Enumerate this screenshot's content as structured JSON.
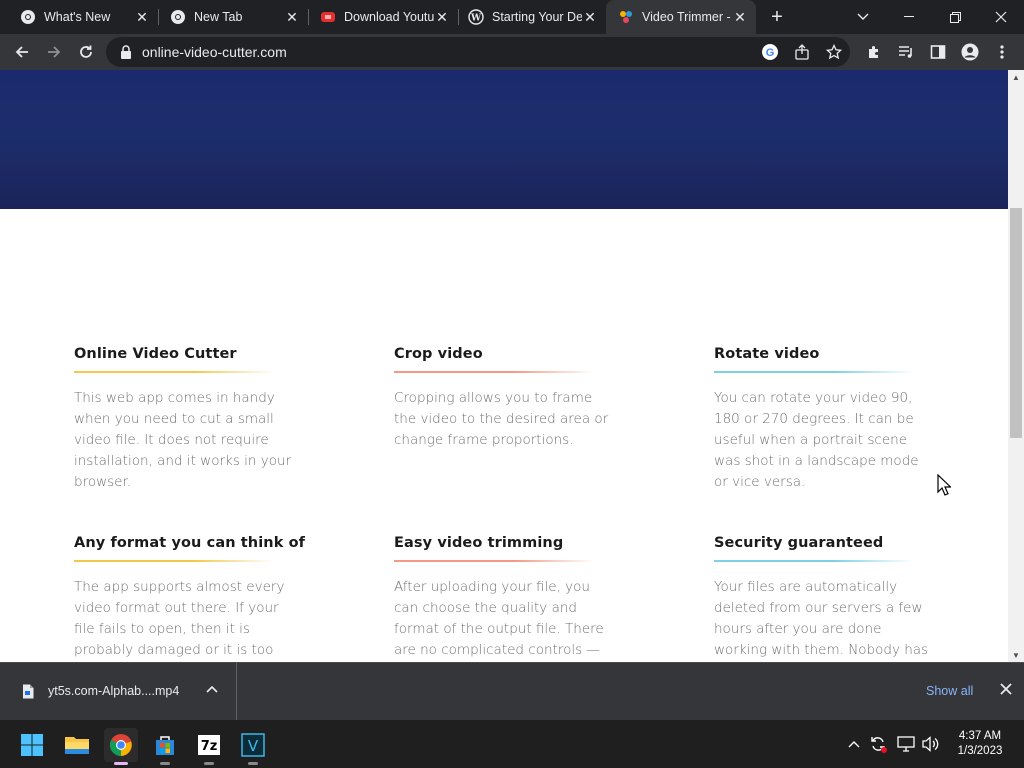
{
  "browser": {
    "tabs": [
      {
        "title": "What's New",
        "favicon": "chrome-logo-icon",
        "active": false
      },
      {
        "title": "New Tab",
        "favicon": "chrome-logo-icon",
        "active": false
      },
      {
        "title": "Download Youtu",
        "favicon": "youtube-download-icon",
        "active": false
      },
      {
        "title": "Starting Your De",
        "favicon": "wordpress-icon",
        "active": false
      },
      {
        "title": "Video Trimmer -",
        "favicon": "video-trimmer-icon",
        "active": true
      }
    ],
    "url": "online-video-cutter.com"
  },
  "page": {
    "features": [
      {
        "title": "Online Video Cutter",
        "text": "This web app comes in handy when you need to cut a small video file. It does not require installation, and it works in your browser.",
        "accent": "#f3c84a"
      },
      {
        "title": "Crop video",
        "text": "Cropping allows you to frame the video to the desired area or change frame proportions.",
        "accent": "#f29a86"
      },
      {
        "title": "Rotate video",
        "text": "You can rotate your video 90, 180 or 270 degrees. It can be useful when a portrait scene was shot in a landscape mode or vice versa.",
        "accent": "#7fd0e6"
      },
      {
        "title": "Any format you can think of",
        "text": "The app supports almost every video format out there. If your file fails to open, then it is probably damaged or it is too",
        "accent": "#f3c84a"
      },
      {
        "title": "Easy video trimming",
        "text": "After uploading your file, you can choose the quality and format of the output file. There are no complicated controls —",
        "accent": "#f29a86"
      },
      {
        "title": "Security guaranteed",
        "text": "Your files are automatically deleted from our servers a few hours after you are done working with them. Nobody has",
        "accent": "#7fd0e6"
      }
    ],
    "hero_color": "#1b2a6e"
  },
  "downloads": {
    "file_name": "yt5s.com-Alphab....mp4",
    "show_all": "Show all"
  },
  "taskbar": {
    "apps": [
      "start-icon",
      "file-explorer-icon",
      "chrome-icon",
      "microsoft-store-icon",
      "7zip-icon",
      "vegas-icon"
    ],
    "time": "4:37 AM",
    "date": "1/3/2023"
  }
}
